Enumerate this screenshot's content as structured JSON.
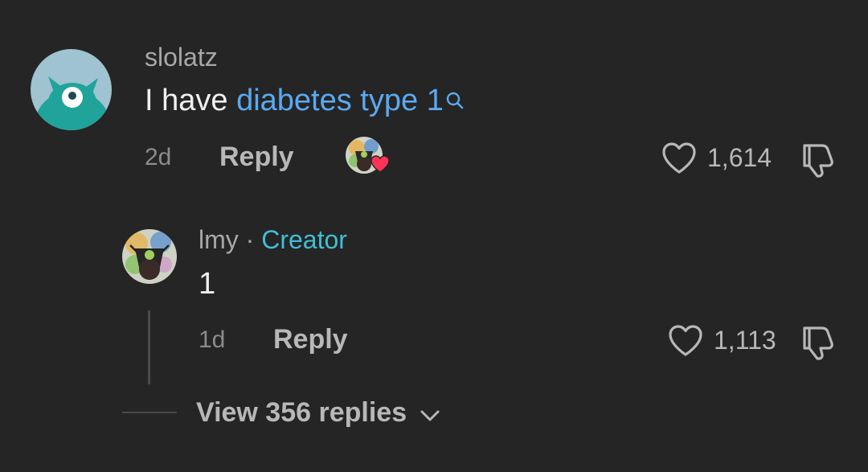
{
  "comment": {
    "username": "slolatz",
    "text_prefix": "I have ",
    "text_link": "diabetes type 1",
    "time": "2d",
    "reply_label": "Reply",
    "likes": "1,614"
  },
  "reply": {
    "username": "lmy",
    "separator": " · ",
    "badge": "Creator",
    "text": "1",
    "time": "1d",
    "reply_label": "Reply",
    "likes": "1,113"
  },
  "view_replies": {
    "label": "View 356 replies"
  },
  "colors": {
    "background": "#252525",
    "link": "#5aa9f0",
    "creator": "#3fbfd6",
    "heart_badge": "#ff3355"
  },
  "icons": {
    "search": "search-icon",
    "heart": "heart-outline-icon",
    "dislike": "thumbs-down-icon",
    "chevron": "chevron-down-icon"
  }
}
